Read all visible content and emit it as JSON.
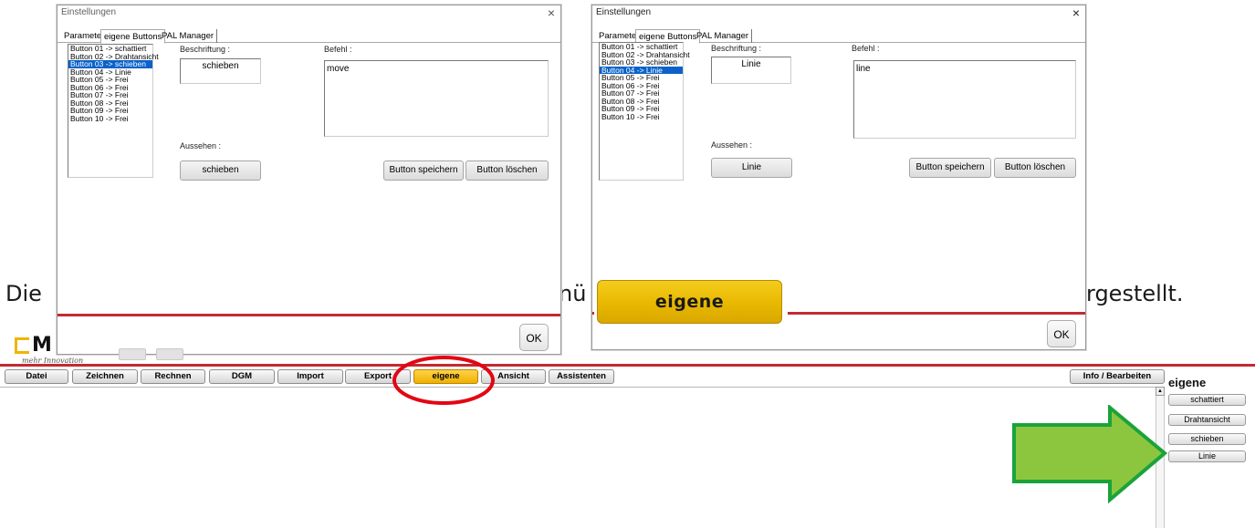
{
  "prose": {
    "start": "Die",
    "mid": "nü",
    "end": "rgestellt."
  },
  "dialog_left": {
    "title": "Einstellungen",
    "tabs": [
      "Parameter",
      "eigene Buttons",
      "PAL Manager"
    ],
    "list": [
      "Button 01 -> schattiert",
      "Button 02 -> Drahtansicht",
      "Button 03 -> schieben",
      "Button 04 -> Linie",
      "Button 05 -> Frei",
      "Button 06 -> Frei",
      "Button 07 -> Frei",
      "Button 08 -> Frei",
      "Button 09 -> Frei",
      "Button 10 -> Frei"
    ],
    "selected_index": 2,
    "label_caption": "Beschriftung :",
    "label_command": "Befehl :",
    "caption_value": "schieben",
    "command_value": "move",
    "label_look": "Aussehen :",
    "preview_button": "schieben",
    "save_button": "Button speichern",
    "delete_button": "Button löschen",
    "ok_button": "OK",
    "close_glyph": "×"
  },
  "dialog_right": {
    "title": "Einstellungen",
    "tabs": [
      "Parameter",
      "eigene Buttons",
      "PAL Manager"
    ],
    "list": [
      "Button 01 -> schattiert",
      "Button 02 -> Drahtansicht",
      "Button 03 -> schieben",
      "Button 04 -> Linie",
      "Button 05 -> Frei",
      "Button 06 -> Frei",
      "Button 07 -> Frei",
      "Button 08 -> Frei",
      "Button 09 -> Frei",
      "Button 10 -> Frei"
    ],
    "selected_index": 3,
    "label_caption": "Beschriftung :",
    "label_command": "Befehl :",
    "caption_value": "Linie",
    "command_value": "line",
    "label_look": "Aussehen :",
    "preview_button": "Linie",
    "save_button": "Button speichern",
    "delete_button": "Button löschen",
    "ok_button": "OK",
    "close_glyph": "×"
  },
  "big_button": "eigene",
  "logo": {
    "letter": "M",
    "tagline": "mehr Innovation"
  },
  "toolbar": [
    "Datei",
    "Zeichnen",
    "Rechnen",
    "DGM",
    "Import",
    "Export",
    "eigene",
    "Ansicht",
    "Assistenten"
  ],
  "toolbar_right": "Info / Bearbeiten",
  "panel": {
    "title": "eigene",
    "buttons": [
      "schattiert",
      "Drahtansicht",
      "schieben",
      "Linie"
    ]
  },
  "colors": {
    "accent_red": "#c32a31",
    "highlight_yellow": "#efb100",
    "arrow_green": "#8cc63f",
    "arrow_border": "#1aa33a",
    "selection_blue": "#0a62c9"
  }
}
